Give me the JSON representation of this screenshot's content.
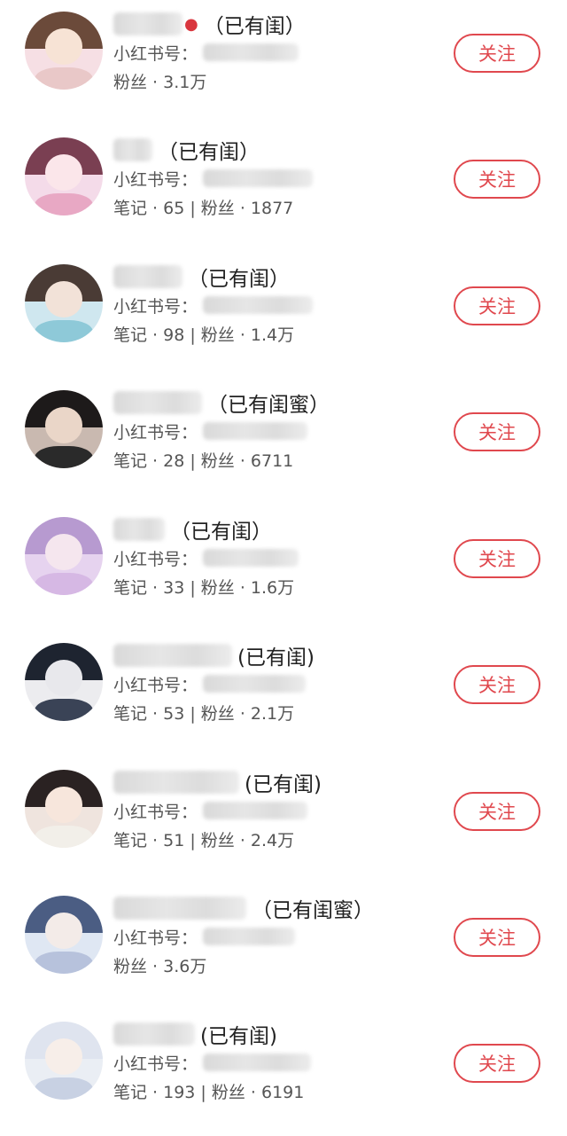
{
  "follow_label": "关注",
  "id_prefix": "小红书号：",
  "users": [
    {
      "suffix": "（已有闺）",
      "berry": true,
      "stats": "粉丝 · 3.1万",
      "avatar": {
        "bg": "#f6dfe4",
        "hair": "#6b4a3a",
        "face": "#f7e3d5",
        "body": "#e9c8c8"
      }
    },
    {
      "suffix": "（已有闺）",
      "berry": false,
      "stats": "笔记 · 65 | 粉丝 · 1877",
      "avatar": {
        "bg": "#f4dbe9",
        "hair": "#7a3f52",
        "face": "#fbe6ea",
        "body": "#e8a8c4"
      }
    },
    {
      "suffix": "（已有闺）",
      "berry": false,
      "stats": "笔记 · 98 | 粉丝 · 1.4万",
      "avatar": {
        "bg": "#cfe7ef",
        "hair": "#4a3b35",
        "face": "#f2e2d8",
        "body": "#8ec9d8"
      }
    },
    {
      "suffix": "（已有闺蜜）",
      "berry": false,
      "stats": "笔记 · 28 | 粉丝 · 6711",
      "avatar": {
        "bg": "#c9b9b0",
        "hair": "#1d1a1a",
        "face": "#ead6c8",
        "body": "#2a2a2a"
      }
    },
    {
      "suffix": "（已有闺）",
      "berry": false,
      "stats": "笔记 · 33 | 粉丝 · 1.6万",
      "avatar": {
        "bg": "#e6d3ef",
        "hair": "#b79ad0",
        "face": "#f5e6ee",
        "body": "#d6b8e4"
      }
    },
    {
      "suffix": "(已有闺)",
      "berry": false,
      "stats": "笔记 · 53 | 粉丝 · 2.1万",
      "avatar": {
        "bg": "#ececef",
        "hair": "#1e2430",
        "face": "#e8e8ec",
        "body": "#3a4356"
      }
    },
    {
      "suffix": "(已有闺)",
      "berry": false,
      "stats": "笔记 · 51 | 粉丝 · 2.4万",
      "avatar": {
        "bg": "#efe4de",
        "hair": "#2a2222",
        "face": "#f7e6dc",
        "body": "#f2efe9"
      }
    },
    {
      "suffix": "（已有闺蜜）",
      "berry": false,
      "stats": "粉丝 · 3.6万",
      "avatar": {
        "bg": "#dfe7f3",
        "hair": "#4b5d83",
        "face": "#f3ebe8",
        "body": "#b7c2dc"
      }
    },
    {
      "suffix": "(已有闺)",
      "berry": false,
      "stats": "笔记 · 193 | 粉丝 · 6191",
      "avatar": {
        "bg": "#eaeef4",
        "hair": "#dfe4ef",
        "face": "#f7eee9",
        "body": "#c8d1e3"
      }
    }
  ]
}
